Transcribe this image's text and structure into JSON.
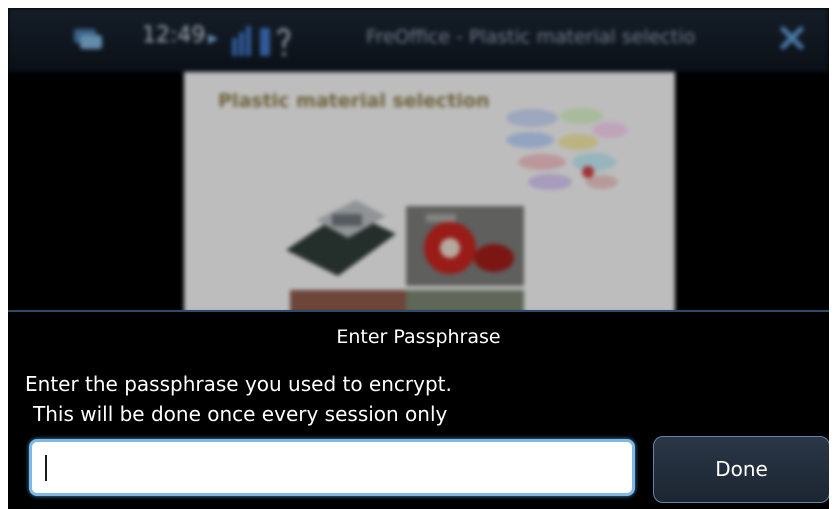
{
  "status_bar": {
    "clock": "12:49",
    "window_title": "FreOffice - Plastic material selectio"
  },
  "document": {
    "slide_title": "Plastic material selection"
  },
  "dialog": {
    "title": "Enter Passphrase",
    "message_line1": "Enter the passphrase you used to encrypt.",
    "message_line2": "This will be done once every session only",
    "input_value": "",
    "done_label": "Done"
  },
  "colors": {
    "dialog_background": "#000000",
    "input_focus_border": "#7eb8e6",
    "button_border": "#5f86a7",
    "status_bar": "#1b2634"
  }
}
